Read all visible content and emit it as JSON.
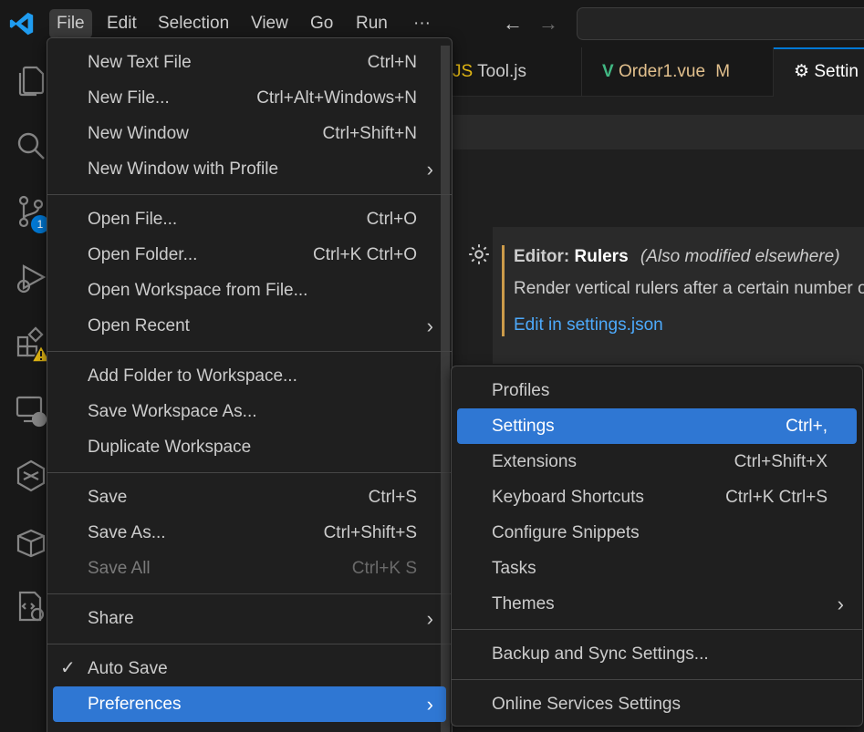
{
  "titlebar": {
    "menus": [
      "File",
      "Edit",
      "Selection",
      "View",
      "Go",
      "Run",
      "···"
    ]
  },
  "activitybar": {
    "scm_badge": "1"
  },
  "tabs": [
    {
      "label": "Tool.js"
    },
    {
      "label": "Order1.vue",
      "status": "M"
    },
    {
      "label": "Settin"
    }
  ],
  "settings_item": {
    "category": "Editor:",
    "name": "Rulers",
    "modified": "(Also modified elsewhere)",
    "description": "Render vertical rulers after a certain number o",
    "link": "Edit in settings.json"
  },
  "file_menu": {
    "items": [
      {
        "label": "New Text File",
        "key": "Ctrl+N"
      },
      {
        "label": "New File...",
        "key": "Ctrl+Alt+Windows+N"
      },
      {
        "label": "New Window",
        "key": "Ctrl+Shift+N"
      },
      {
        "label": "New Window with Profile",
        "key": ""
      },
      {
        "label": "Open File...",
        "key": "Ctrl+O"
      },
      {
        "label": "Open Folder...",
        "key": "Ctrl+K Ctrl+O"
      },
      {
        "label": "Open Workspace from File...",
        "key": ""
      },
      {
        "label": "Open Recent",
        "key": ""
      },
      {
        "label": "Add Folder to Workspace...",
        "key": ""
      },
      {
        "label": "Save Workspace As...",
        "key": ""
      },
      {
        "label": "Duplicate Workspace",
        "key": ""
      },
      {
        "label": "Save",
        "key": "Ctrl+S"
      },
      {
        "label": "Save As...",
        "key": "Ctrl+Shift+S"
      },
      {
        "label": "Save All",
        "key": "Ctrl+K S"
      },
      {
        "label": "Share",
        "key": ""
      },
      {
        "label": "Auto Save",
        "key": ""
      },
      {
        "label": "Preferences",
        "key": ""
      }
    ]
  },
  "preferences_menu": {
    "items": [
      {
        "label": "Profiles",
        "key": ""
      },
      {
        "label": "Settings",
        "key": "Ctrl+,"
      },
      {
        "label": "Extensions",
        "key": "Ctrl+Shift+X"
      },
      {
        "label": "Keyboard Shortcuts",
        "key": "Ctrl+K Ctrl+S"
      },
      {
        "label": "Configure Snippets",
        "key": ""
      },
      {
        "label": "Tasks",
        "key": ""
      },
      {
        "label": "Themes",
        "key": ""
      },
      {
        "label": "Backup and Sync Settings...",
        "key": ""
      },
      {
        "label": "Online Services Settings",
        "key": ""
      }
    ]
  },
  "colors": {
    "accent": "#0078d4",
    "highlight": "#2f77d3",
    "vue_green": "#41b883",
    "modified": "#e2c08d",
    "link": "#4daafc"
  }
}
